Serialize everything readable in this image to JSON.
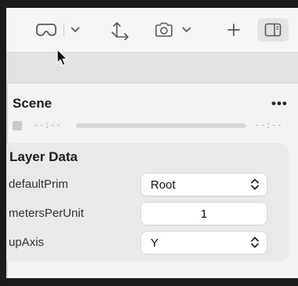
{
  "toolbar": {
    "items": [
      {
        "icon": "vr-headset-icon"
      },
      {
        "icon": "chevron-down-icon"
      },
      {
        "icon": "transform-icon"
      },
      {
        "icon": "camera-icon"
      },
      {
        "icon": "chevron-down-icon"
      },
      {
        "icon": "plus-icon"
      },
      {
        "icon": "inspector-toggle-icon"
      }
    ]
  },
  "scene": {
    "title": "Scene",
    "more_label": "•••",
    "time_start": "--:--",
    "time_end": "--:--"
  },
  "layer_data": {
    "title": "Layer Data",
    "rows": [
      {
        "label": "defaultPrim",
        "value": "Root"
      },
      {
        "label": "metersPerUnit",
        "value": "1"
      },
      {
        "label": "upAxis",
        "value": "Y"
      }
    ]
  }
}
